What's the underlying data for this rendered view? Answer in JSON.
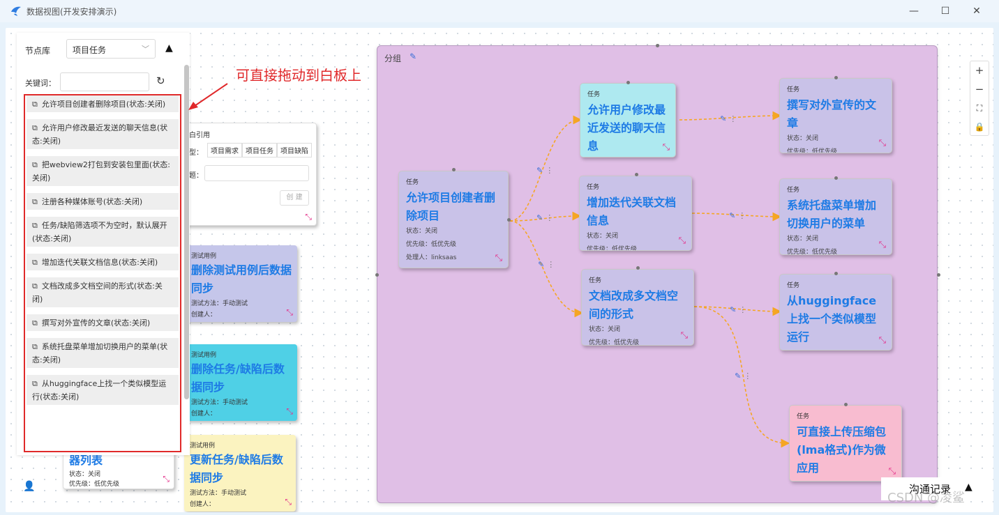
{
  "window": {
    "title": "数据视图(开发安排演示)",
    "minimize": "—",
    "maximize": "☐",
    "close": "✕"
  },
  "group": {
    "title": "分组"
  },
  "cards": {
    "root": {
      "kind": "任务",
      "title": "允许项目创建者删除项目",
      "status": "状态：关闭",
      "priority": "优先级：低优先级",
      "handler": "处理人：linksaas"
    },
    "c1": {
      "kind": "任务",
      "title": "允许用户修改最近发送的聊天信息"
    },
    "c2": {
      "kind": "任务",
      "title": "增加迭代关联文档信息",
      "status": "状态：关闭",
      "priority": "优先级：低优先级"
    },
    "c3": {
      "kind": "任务",
      "title": "文档改成多文档空间的形式",
      "status": "状态：关闭",
      "priority": "优先级：低优先级"
    },
    "r1": {
      "kind": "任务",
      "title": "撰写对外宣传的文章",
      "status": "状态：关闭",
      "priority": "优先级：低优先级"
    },
    "r2": {
      "kind": "任务",
      "title": "系统托盘菜单增加切换用户的菜单",
      "status": "状态：关闭",
      "priority": "优先级：低优先级"
    },
    "r3": {
      "kind": "任务",
      "title": "从huggingface上找一个类似模型运行"
    },
    "r4": {
      "kind": "任务",
      "title": "可直接上传压缩包(lma格式)作为微应用"
    }
  },
  "left_cards": {
    "ref": {
      "title": "白引用",
      "type_label": "型：",
      "tabs": [
        "项目需求",
        "项目任务",
        "项目缺陷"
      ],
      "topic_label": "题：",
      "create": "创 建"
    },
    "t1": {
      "kind": "测试用例",
      "title": "删除测试用例后数据同步",
      "method": "测试方法：手动测试",
      "creator": "创建人："
    },
    "t2": {
      "kind": "测试用例",
      "title": "删除任务/缺陷后数据同步",
      "method": "测试方法：手动测试",
      "creator": "创建人："
    },
    "t3": {
      "kind": "测试用例",
      "title": "更新任务/缺陷后数据同步",
      "method": "测试方法：手动测试",
      "creator": "创建人："
    },
    "t4": {
      "title": "器列表",
      "status": "状态：关闭",
      "priority": "优先级：低优先级"
    }
  },
  "library": {
    "label": "节点库",
    "selected": "项目任务",
    "keyword_label": "关键词：",
    "keyword_value": "",
    "items": [
      "允许项目创建者删除项目(状态:关闭)",
      "允许用户修改最近发送的聊天信息(状态:关闭)",
      "把webview2打包到安装包里面(状态:关闭)",
      "注册各种媒体账号(状态:关闭)",
      "任务/缺陷筛选项不为空时，默认展开(状态:关闭)",
      "增加迭代关联文档信息(状态:关闭)",
      "文档改成多文档空间的形式(状态:关闭)",
      "撰写对外宣传的文章(状态:关闭)",
      "系统托盘菜单增加切换用户的菜单(状态:关闭)",
      "从huggingface上找一个类似模型运行(状态:关闭)"
    ]
  },
  "annotation": "可直接拖动到白板上",
  "footer": {
    "comm": "沟通记录",
    "watermark": "CSDN @凌鲨"
  },
  "colors": {
    "accent": "#1e7be5",
    "group_bg": "#e0bfe6",
    "edge": "#f5a623",
    "highlight": "#e02a2a"
  }
}
